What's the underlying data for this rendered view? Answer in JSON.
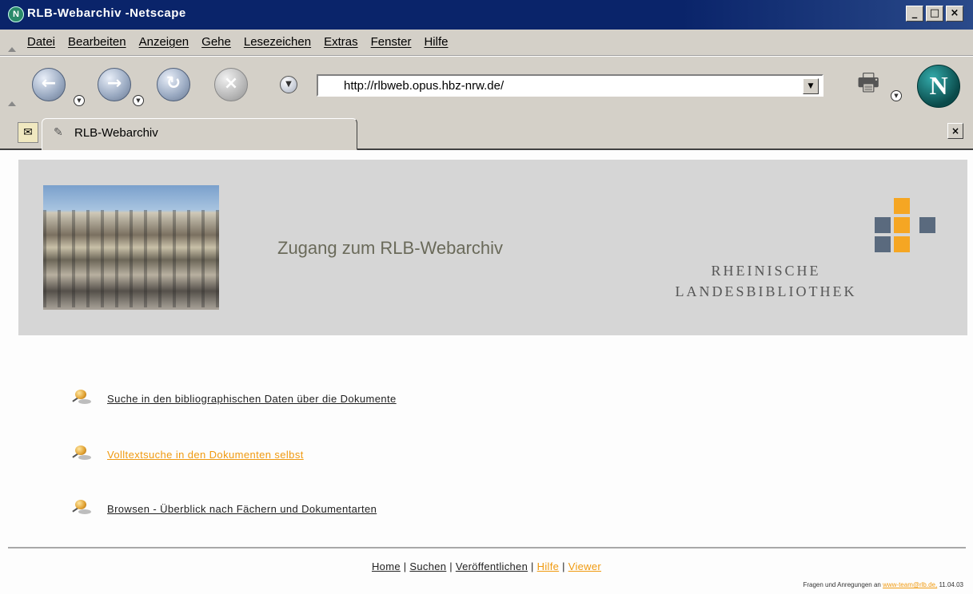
{
  "window": {
    "title": "RLB-Webarchiv -Netscape",
    "logo_glyph": "N"
  },
  "window_controls": {
    "minimize": "_",
    "maximize": "□",
    "close": "×"
  },
  "menu": [
    "Datei",
    "Bearbeiten",
    "Anzeigen",
    "Gehe",
    "Lesezeichen",
    "Extras",
    "Fenster",
    "Hilfe"
  ],
  "nav": {
    "back_glyph": "←",
    "forward_glyph": "→",
    "reload_glyph": "↻",
    "stop_glyph": "×",
    "url": "http://rlbweb.opus.hbz-nrw.de/",
    "logo_glyph": "N"
  },
  "tabs": [
    {
      "label": "RLB-Webarchiv"
    }
  ],
  "header": {
    "title": "Zugang zum RLB-Webarchiv",
    "logo_line1": "RHEINISCHE",
    "logo_line2": "LANDESBIBLIOTHEK",
    "logo_colors": {
      "orange": "#f5a623",
      "slate": "#5a6a7e"
    }
  },
  "links": [
    {
      "label": "Suche in den bibliographischen Daten über die Dokumente"
    },
    {
      "label": "Volltextsuche in den Dokumenten selbst"
    },
    {
      "label": "Browsen - Überblick nach Fächern und Dokumentarten"
    }
  ],
  "footer": {
    "nav": [
      "Home",
      "Suchen",
      "Veröffentlichen",
      "Hilfe",
      "Viewer"
    ],
    "separator": "|",
    "contact_text": "Fragen und Anregungen an ",
    "contact_email": "www-team@rlb.de,",
    "date": " 11.04.03"
  },
  "colors": {
    "accent_orange": "#f09a10",
    "titlebar": "#0a246a",
    "chrome": "#d4d0c8"
  }
}
